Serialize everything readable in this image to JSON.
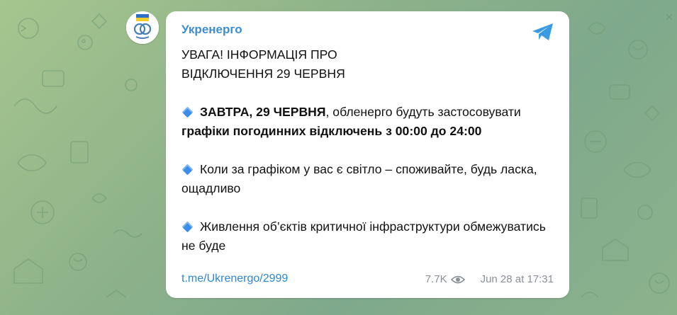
{
  "channel": {
    "name": "Укренерго",
    "avatar_icon": "ukrenergo-logo-icon",
    "accent_color": "#3a8fd3"
  },
  "message": {
    "heading_line1": "УВАГА! ІНФОРМАЦІЯ ПРО",
    "heading_line2": "ВІДКЛЮЧЕННЯ 29 ЧЕРВНЯ",
    "p1_bold1": "ЗАВТРА, 29 ЧЕРВНЯ",
    "p1_text1": ", обленерго будуть застосовувати ",
    "p1_bold2": "графіки погодинних відключень з 00:00 до 24:00",
    "p2_text": "Коли за графіком у вас є світло – споживайте, будь ласка, ощадливо",
    "p3_text": "Живлення об’єктів критичної інфраструктури обмежуватись не буде",
    "bullet_icon": "small-blue-diamond-icon"
  },
  "footer": {
    "link": "t.me/Ukrenergo/2999",
    "views": "7.7K",
    "timestamp": "Jun 28 at 17:31"
  }
}
